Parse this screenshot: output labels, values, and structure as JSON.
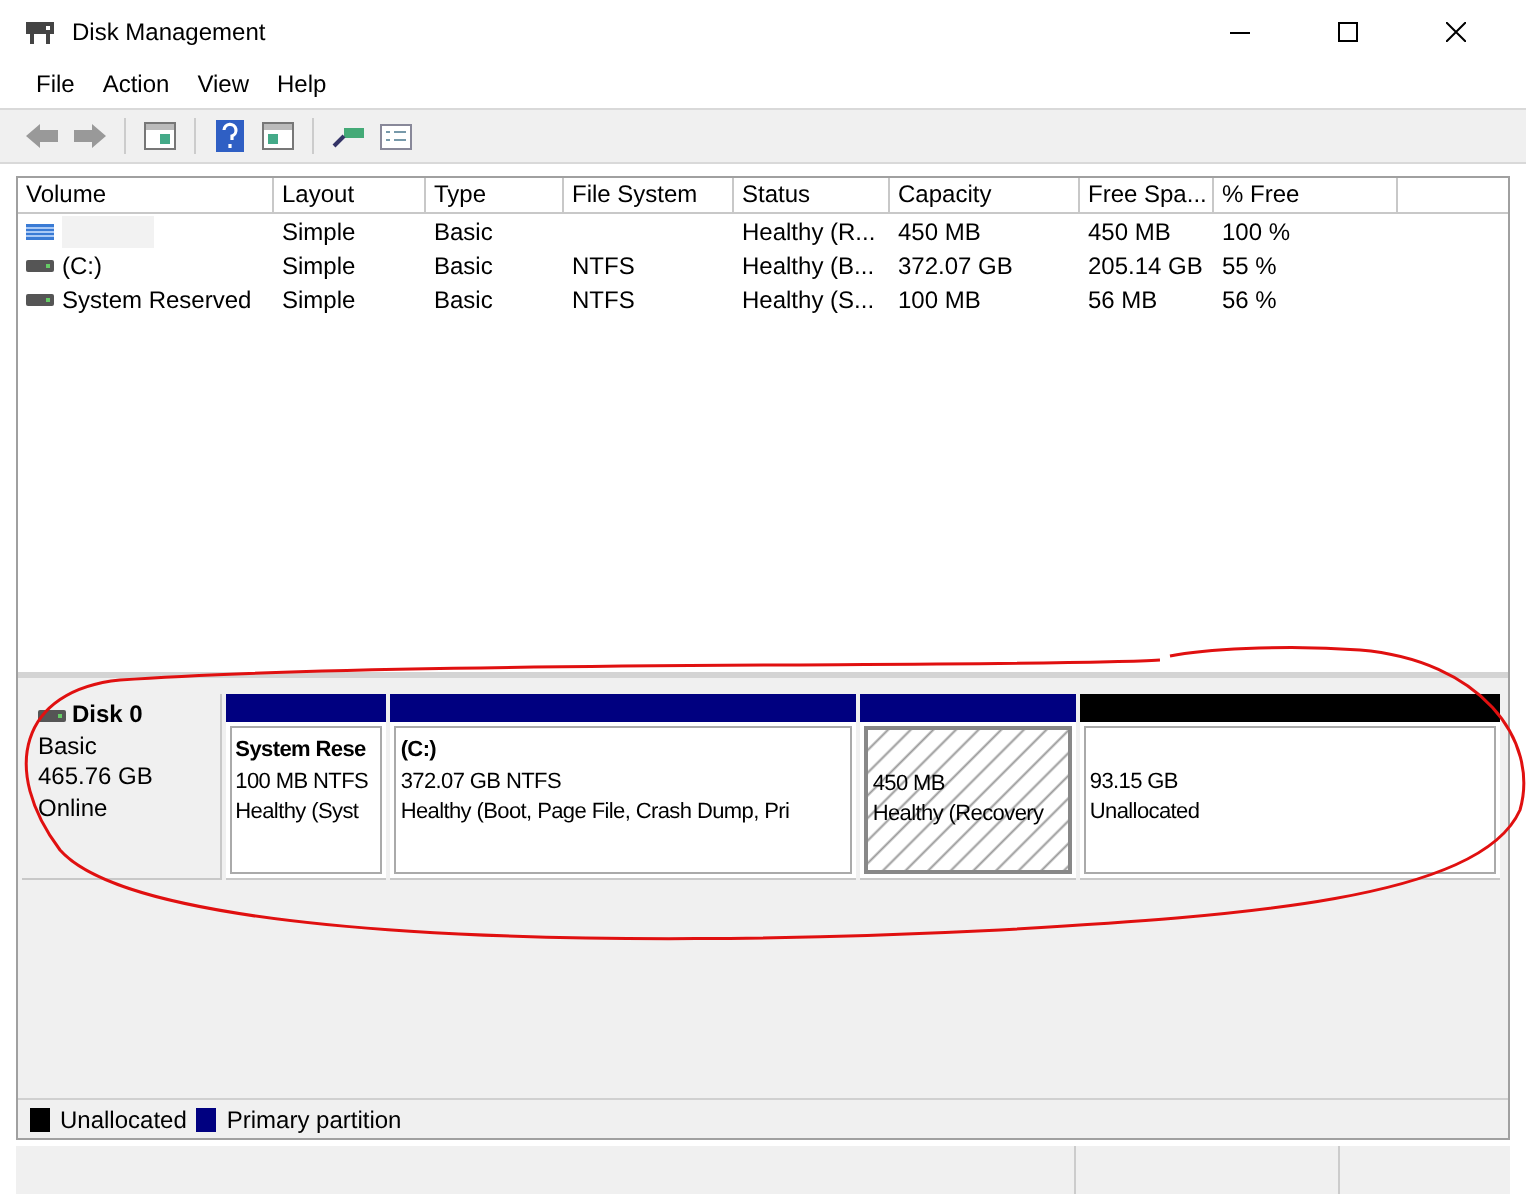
{
  "window": {
    "title": "Disk Management"
  },
  "menu": [
    "File",
    "Action",
    "View",
    "Help"
  ],
  "table": {
    "columns": [
      "Volume",
      "Layout",
      "Type",
      "File System",
      "Status",
      "Capacity",
      "Free Spa...",
      "% Free"
    ],
    "rows": [
      {
        "kind": "striped",
        "redacted": true,
        "cells": [
          "",
          "Simple",
          "Basic",
          "",
          "Healthy (R...",
          "450 MB",
          "450 MB",
          "100 %"
        ]
      },
      {
        "kind": "drive",
        "redacted": false,
        "cells": [
          "(C:)",
          "Simple",
          "Basic",
          "NTFS",
          "Healthy (B...",
          "372.07 GB",
          "205.14 GB",
          "55 %"
        ]
      },
      {
        "kind": "drive",
        "redacted": false,
        "cells": [
          "System Reserved",
          "Simple",
          "Basic",
          "NTFS",
          "Healthy (S...",
          "100 MB",
          "56 MB",
          "56 %"
        ]
      }
    ]
  },
  "disk": {
    "name": "Disk 0",
    "type": "Basic",
    "size": "465.76 GB",
    "status": "Online",
    "partitions": [
      {
        "kind": "primary",
        "selected": false,
        "title": "System Rese",
        "size": "100 MB NTFS",
        "status": "Healthy (Syst"
      },
      {
        "kind": "primary",
        "selected": false,
        "title": "(C:)",
        "size": "372.07 GB NTFS",
        "status": "Healthy (Boot, Page File, Crash Dump, Pri"
      },
      {
        "kind": "primary",
        "selected": true,
        "size": "450 MB",
        "status": "Healthy (Recovery"
      },
      {
        "kind": "unallocated",
        "selected": false,
        "size": "93.15 GB",
        "status": "Unallocated"
      }
    ]
  },
  "legend": [
    {
      "label": "Unallocated",
      "color": "#000000"
    },
    {
      "label": "Primary partition",
      "color": "#000080"
    }
  ]
}
